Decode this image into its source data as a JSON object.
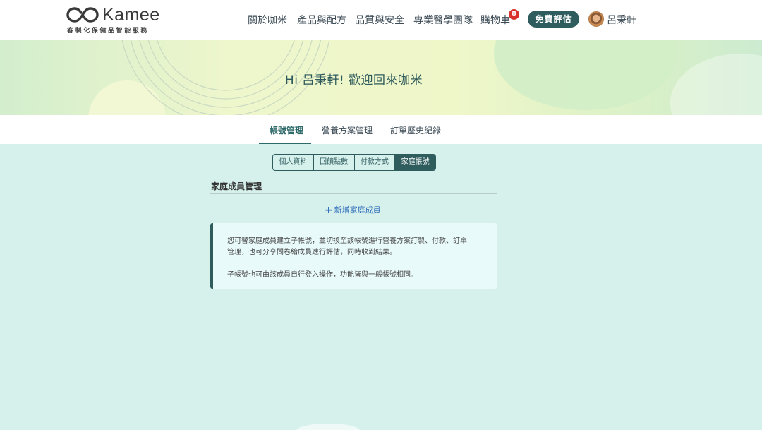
{
  "brand": {
    "name": "Kamee",
    "tagline": "客製化保健品智能服務"
  },
  "nav": {
    "items": [
      "關於咖米",
      "產品與配方",
      "品質與安全",
      "專業醫學團隊",
      "購物車"
    ],
    "cart_count": "8",
    "free_eval_label": "免費評估",
    "user_name": "呂秉軒"
  },
  "banner": {
    "greeting": "Hi 呂秉軒! 歡迎回來咖米"
  },
  "tabs": [
    "帳號管理",
    "營養方案管理",
    "訂單歷史紀錄"
  ],
  "segments": [
    "個人資料",
    "回饋點數",
    "付款方式",
    "家庭帳號"
  ],
  "family": {
    "title": "家庭成員管理",
    "add_label": "新增家庭成員",
    "info_lines": [
      "您可替家庭成員建立子帳號，並切換至該帳號進行營養方案訂製、付款、訂單",
      "管理，也可分享問卷給成員進行評估，同時收到結果。",
      "子帳號也可由該成員自行登入操作，功能皆與一般帳號相同。"
    ]
  },
  "colors": {
    "primary": "#2f5d5e",
    "badge": "#d8312b",
    "link": "#2a6ab8",
    "page_bg": "#d6f0ec"
  }
}
